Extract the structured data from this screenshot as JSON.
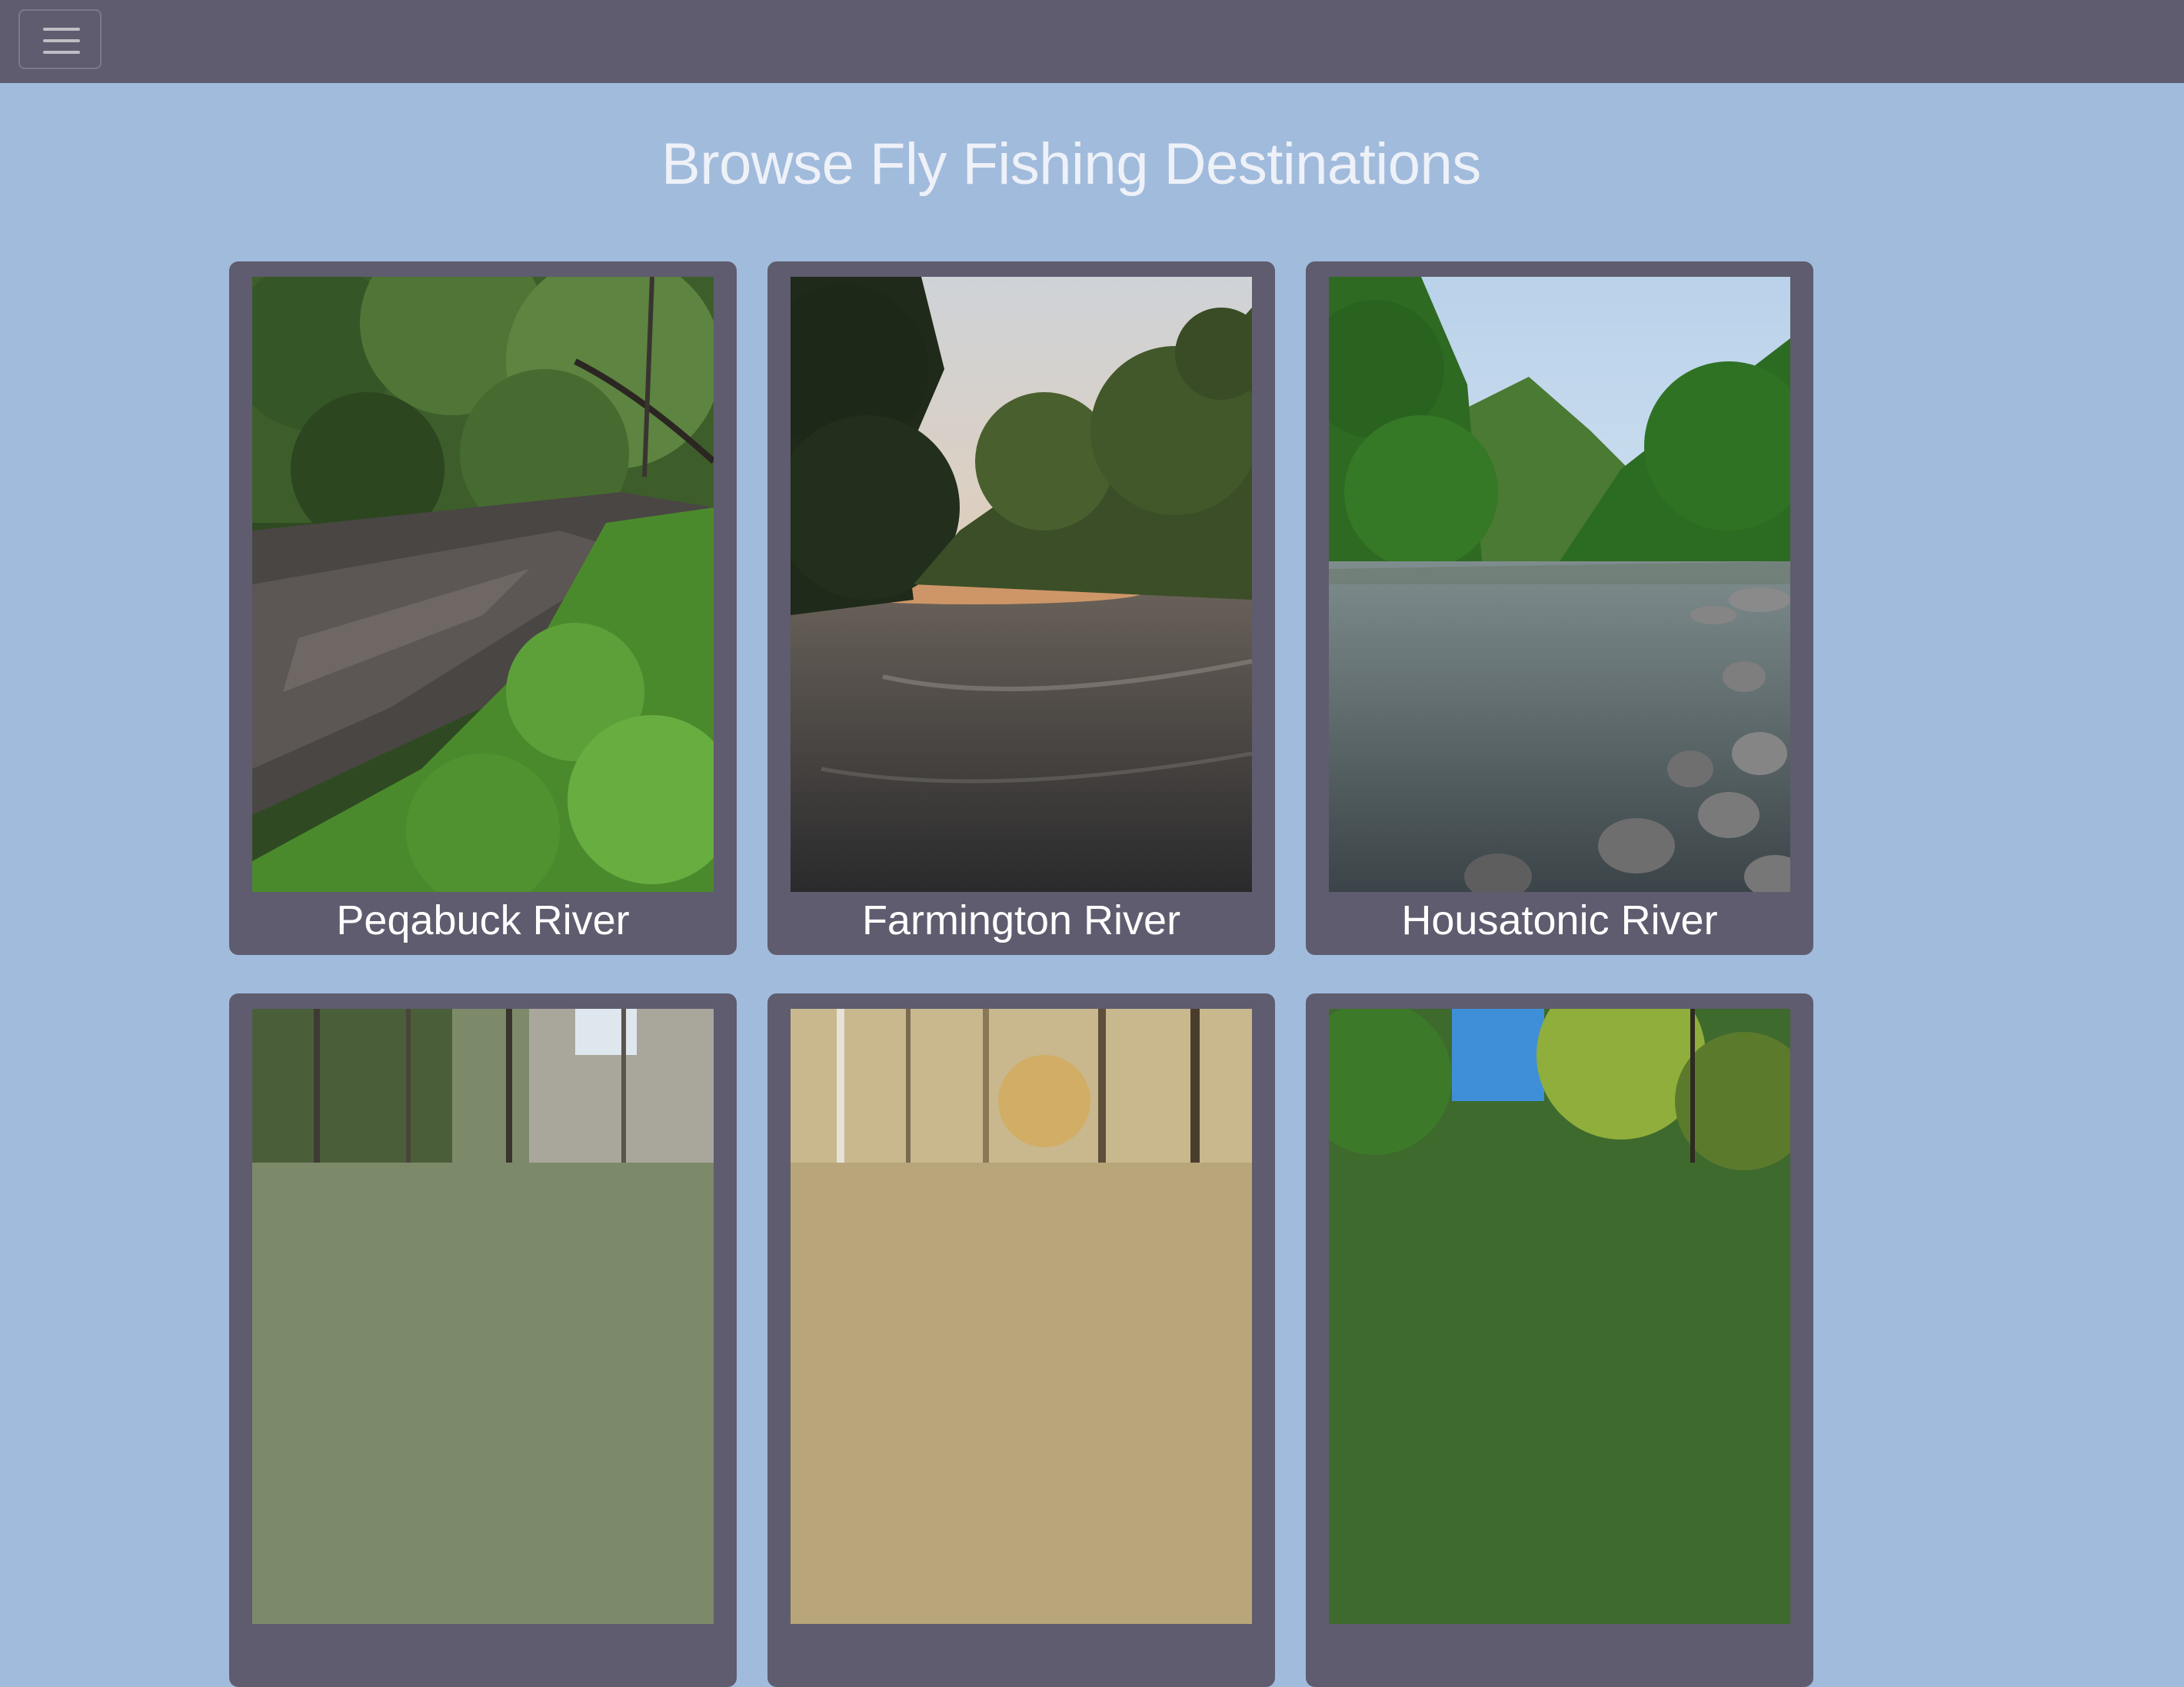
{
  "navbar": {
    "menu_icon": "hamburger-menu-icon"
  },
  "page": {
    "title": "Browse Fly Fishing Destinations"
  },
  "destinations": [
    {
      "name": "Peqabuck River"
    },
    {
      "name": "Farmington River"
    },
    {
      "name": "Housatonic River"
    },
    {
      "name": ""
    },
    {
      "name": ""
    },
    {
      "name": ""
    }
  ],
  "colors": {
    "background": "#a1bbdc",
    "navbar": "#5e5c6e",
    "card": "#5e5c6e",
    "title_text": "#eef1f8",
    "card_text": "#ffffff"
  }
}
